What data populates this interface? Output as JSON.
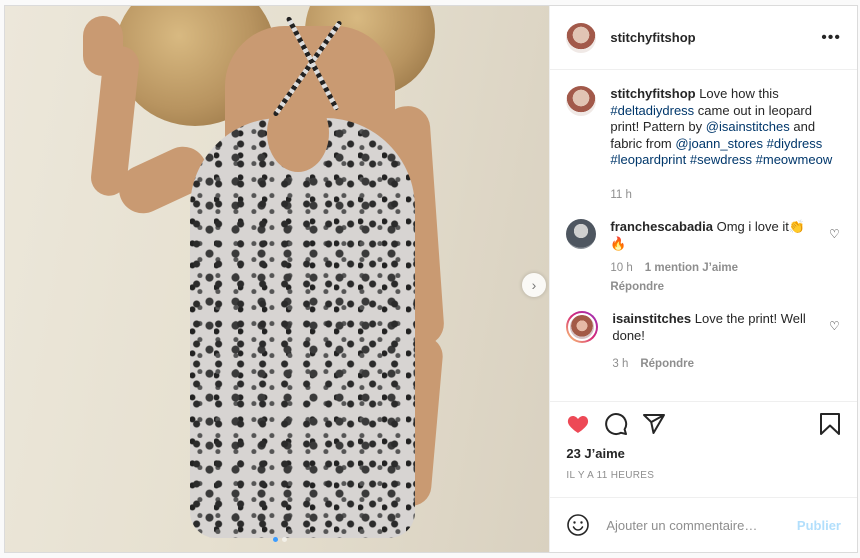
{
  "post": {
    "username": "stitchyfitshop",
    "more_icon": "more-icon",
    "caption": {
      "username": "stitchyfitshop",
      "text_1": " Love how this ",
      "tag_1": "#deltadiydress",
      "text_2": " came out in leopard print! Pattern by ",
      "mention_1": "@isainstitches",
      "text_3": " and fabric from ",
      "mention_2": "@joann_stores",
      "text_4": " ",
      "tag_2": "#diydress",
      "text_5": " ",
      "tag_3": "#leopardprint",
      "text_6": " ",
      "tag_4": "#sewdress",
      "text_7": " ",
      "tag_5": "#meowmeow",
      "time": "11 h"
    },
    "comments": [
      {
        "username": "franchescabadia",
        "text": " Omg i love it👏🔥",
        "time": "10 h",
        "likes": "1 mention J’aime",
        "reply": "Répondre"
      },
      {
        "username": "isainstitches",
        "text": " Love the print! Well done!",
        "time": "3 h",
        "reply": "Répondre"
      }
    ],
    "likes": "23 J’aime",
    "timestamp": "IL Y A 11 HEURES",
    "add_comment_placeholder": "Ajouter un commentaire…",
    "publish_label": "Publier",
    "like_color": "#ed4956",
    "carousel": {
      "slides": 2,
      "active": 1
    }
  }
}
